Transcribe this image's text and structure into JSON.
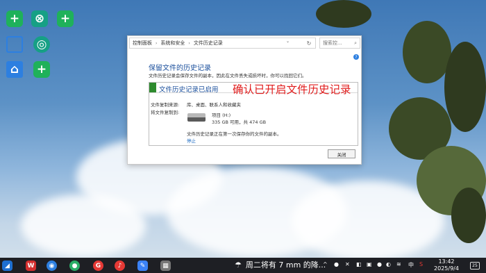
{
  "window": {
    "breadcrumb": [
      "控制面板",
      "系统和安全",
      "文件历史记录"
    ],
    "search_placeholder": "搜索控...",
    "help_glyph": "?",
    "title": "保留文件的历史记录",
    "description": "文件历史记录会保存文件的副本，因此在文件丢失或损坏时，你可以找回它们。",
    "status": "文件历史记录已启用",
    "copy_from_label": "文件复制来源:",
    "copy_from_value": "库、桌面、联系人和收藏夹",
    "copy_to_label": "将文件复制到:",
    "drive_name": "项目 (H:)",
    "drive_space": "335 GB 可用，共 474 GB",
    "saving_note": "文件历史记录正在第一次保存你的文件的副本。",
    "stop_link": "停止",
    "close_button": "关闭"
  },
  "annotation": "确认已开启文件历史记录",
  "taskbar": {
    "weather_text": "周二将有 7 mm 的降...",
    "tray_lang": "中",
    "time": "13:42",
    "date": "2025/9/4",
    "notification_count": "25"
  }
}
